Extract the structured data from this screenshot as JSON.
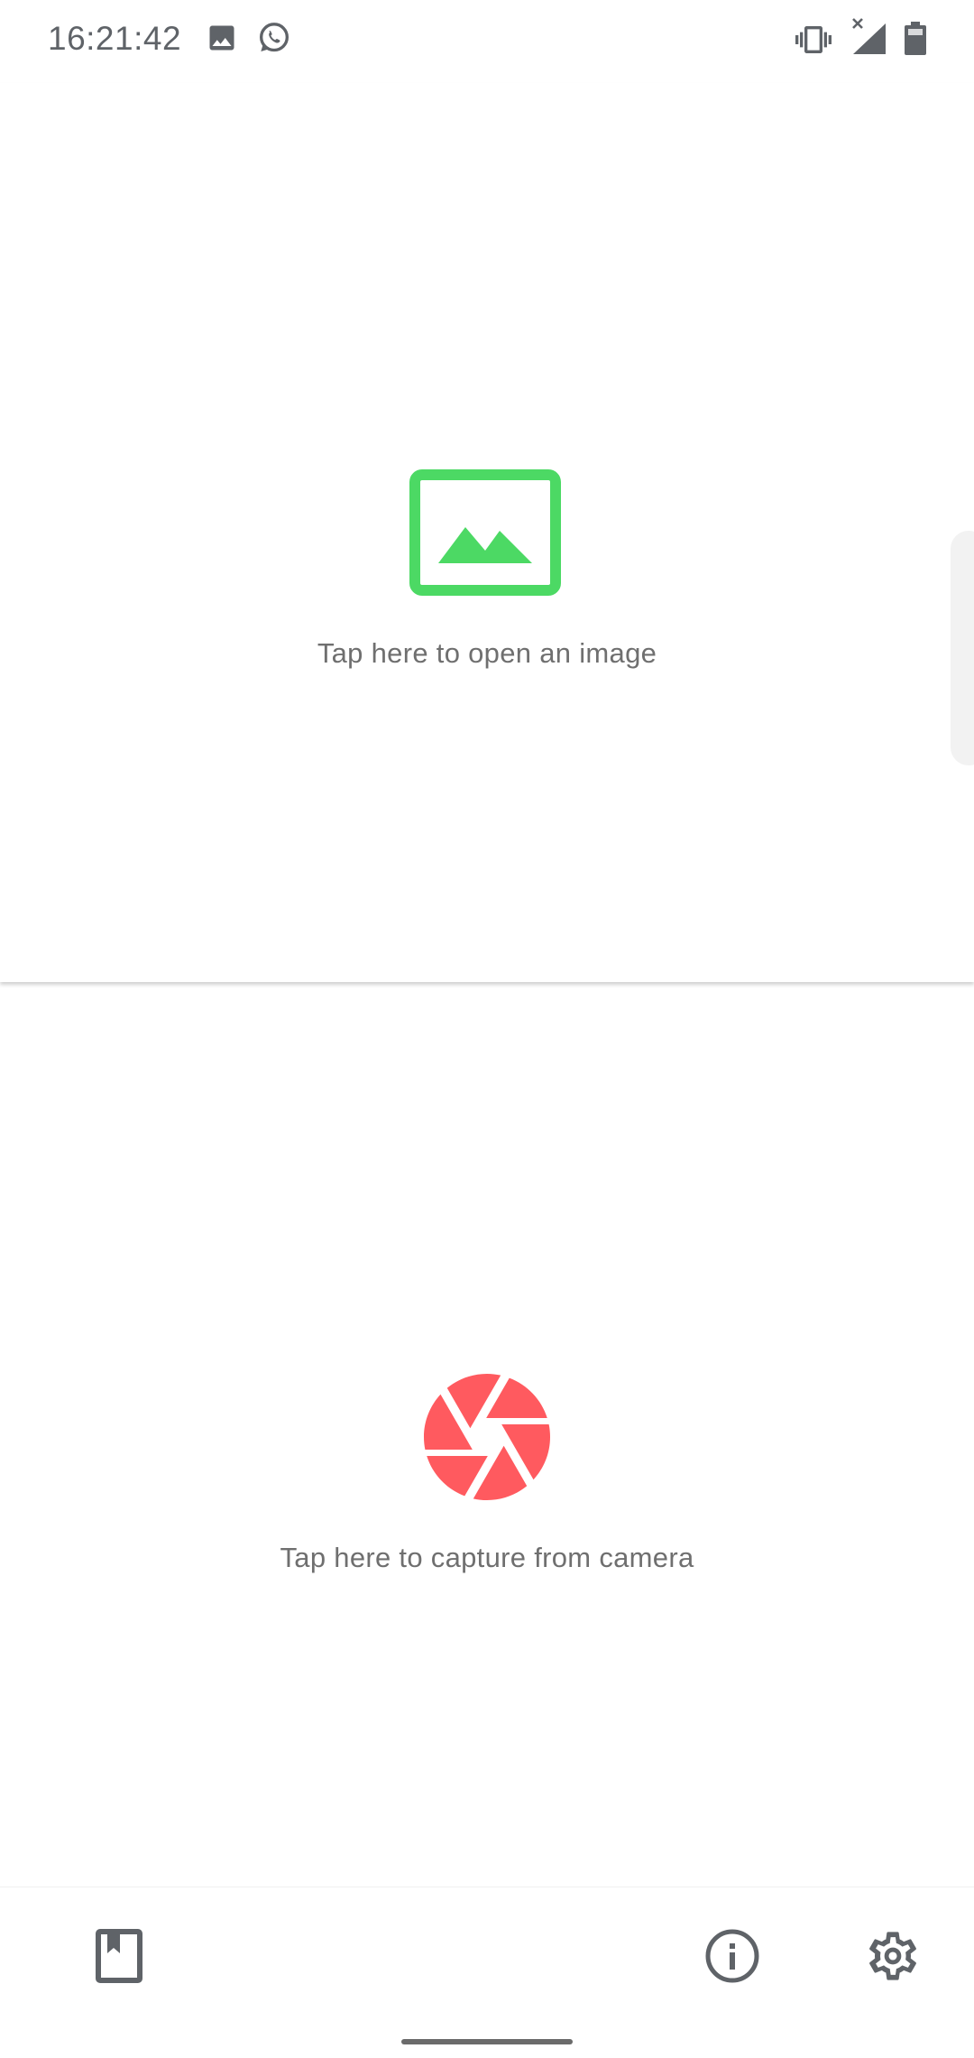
{
  "status_bar": {
    "time": "16:21:42",
    "left_icons": [
      "gallery-icon",
      "whatsapp-icon"
    ],
    "right_icons": [
      "vibrate-icon",
      "signal-no-service-icon",
      "battery-icon"
    ]
  },
  "open_image": {
    "icon": "image-icon",
    "label": "Tap here to open an image",
    "color": "#4cd964"
  },
  "capture_camera": {
    "icon": "camera-shutter-icon",
    "label": "Tap here to capture from camera",
    "color": "#ff5a5f"
  },
  "toolbar": {
    "items": [
      "bookmarks-icon",
      "info-icon",
      "settings-icon"
    ]
  },
  "colors": {
    "text": "#6f6f6f",
    "icon": "#5f6368",
    "background": "#ffffff"
  }
}
